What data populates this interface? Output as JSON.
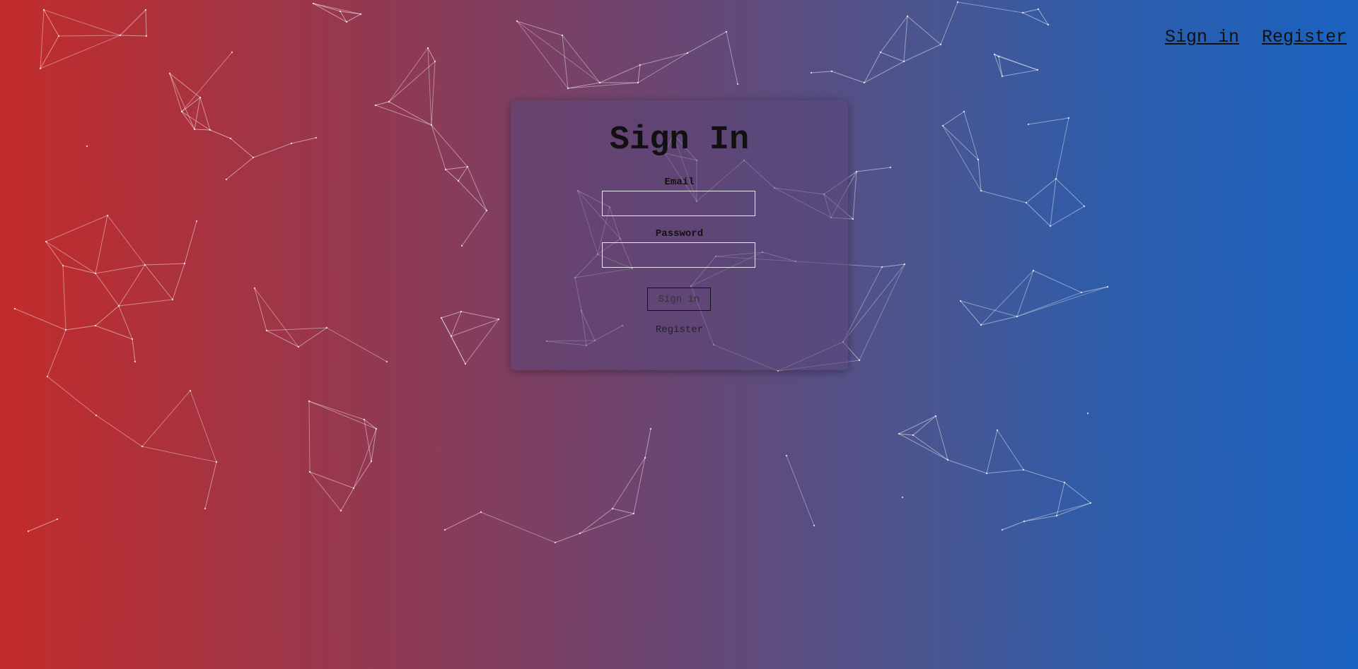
{
  "nav": {
    "sign_in": "Sign in",
    "register": "Register"
  },
  "form": {
    "title": "Sign In",
    "email_label": "Email",
    "email_value": "",
    "password_label": "Password",
    "password_value": "",
    "submit_label": "Sign in",
    "register_link": "Register"
  },
  "theme": {
    "gradient_left": "#c22c2a",
    "gradient_right": "#1a62c0",
    "card_background": "#5a4678",
    "line_color": "#ffffff"
  }
}
